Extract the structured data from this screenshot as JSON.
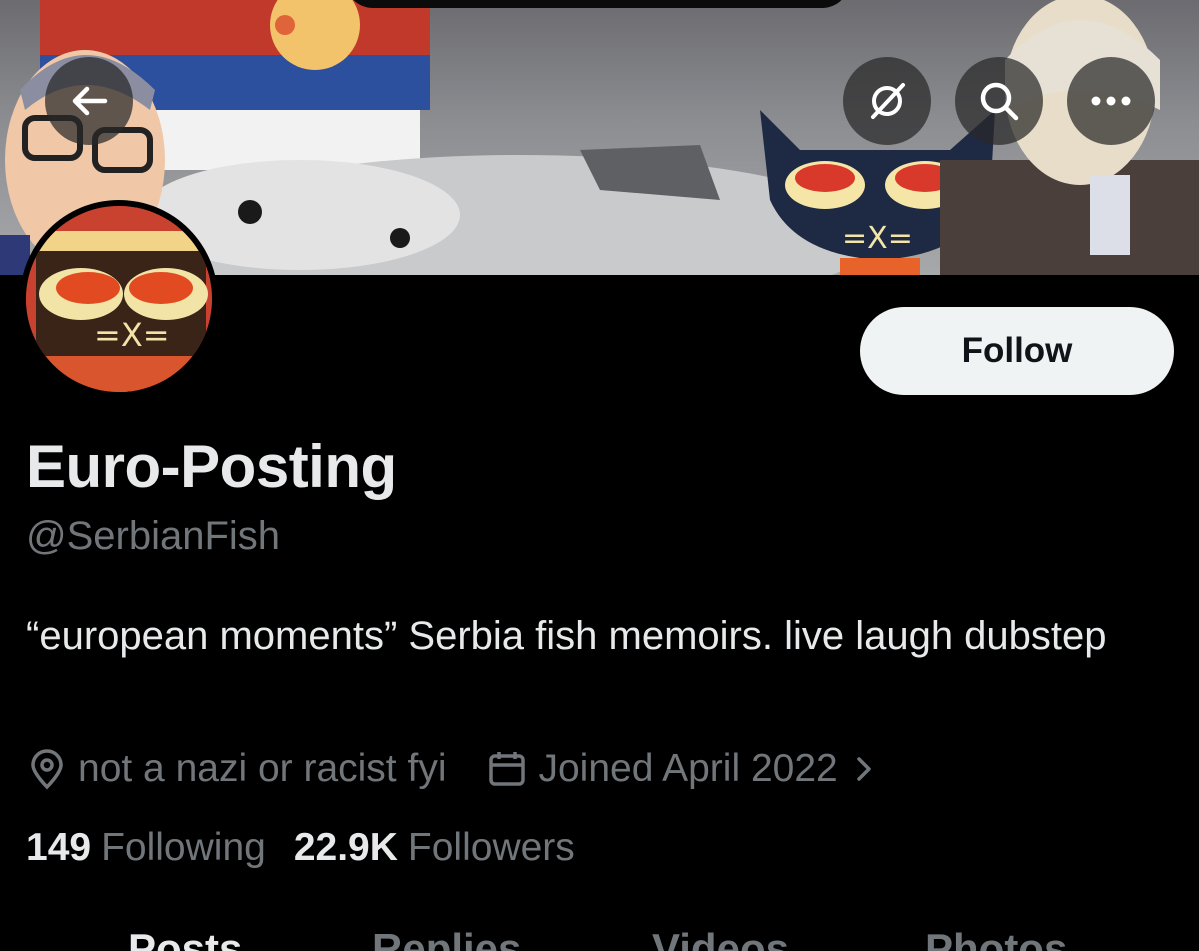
{
  "header": {
    "back_icon": "arrow-left-icon",
    "grok_icon": "grok-icon",
    "search_icon": "search-icon",
    "more_icon": "ellipsis-icon"
  },
  "profile": {
    "display_name": "Euro-Posting",
    "handle": "@SerbianFish",
    "bio": "“european moments” Serbia fish memoirs. live laugh dubstep",
    "location": "not a nazi or racist fyi",
    "joined": "Joined April 2022",
    "follow_label": "Follow"
  },
  "stats": {
    "following_count": "149",
    "following_label": "Following",
    "followers_count": "22.9K",
    "followers_label": "Followers"
  },
  "tabs": [
    {
      "label": "Posts",
      "active": true
    },
    {
      "label": "Replies",
      "active": false
    },
    {
      "label": "Videos",
      "active": false
    },
    {
      "label": "Photos",
      "active": false
    }
  ],
  "colors": {
    "background": "#000000",
    "primary_text": "#e7e9ea",
    "secondary_text": "#71767b",
    "follow_button_bg": "#eff3f4",
    "follow_button_text": "#0f1419"
  }
}
